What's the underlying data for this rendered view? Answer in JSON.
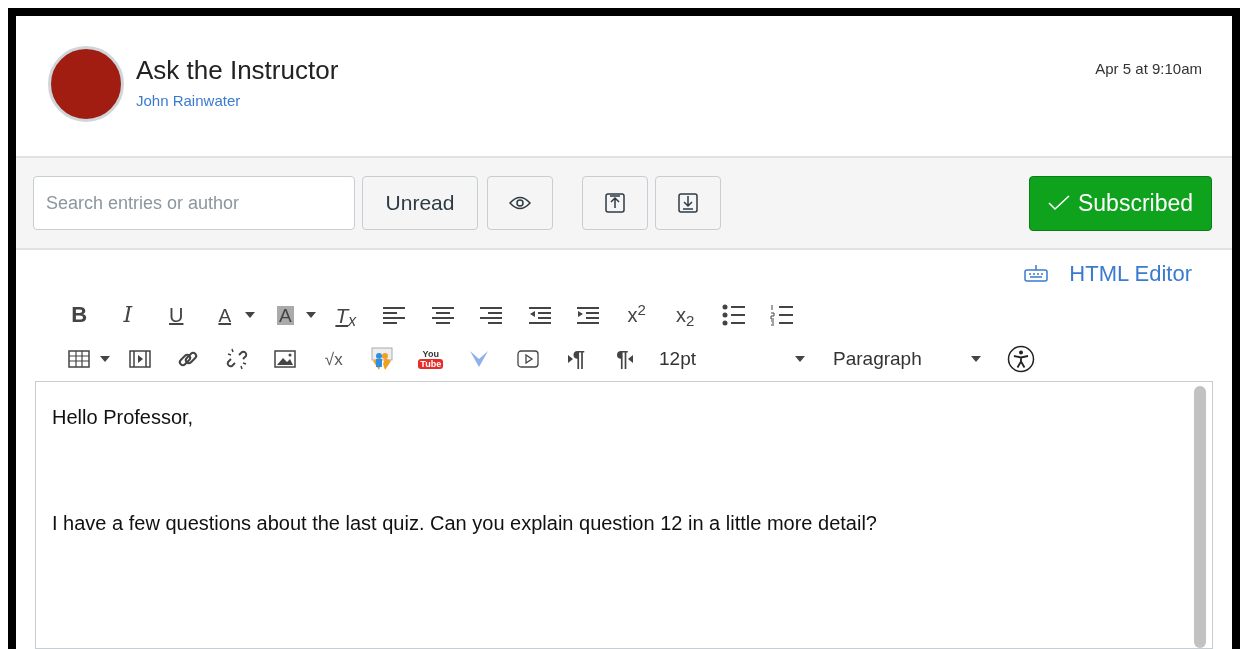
{
  "post": {
    "title": "Ask the Instructor",
    "author": "John Rainwater",
    "timestamp": "Apr 5 at 9:10am"
  },
  "toolbar": {
    "search": {
      "placeholder": "Search entries or author"
    },
    "unread_button": "Unread",
    "subscribe_button": {
      "label": "Subscribed",
      "subscribed": true
    }
  },
  "editor": {
    "html_editor_link": "HTML Editor",
    "row_1": [
      {
        "kind": "bold",
        "text": "B"
      },
      {
        "kind": "italic",
        "text": "I"
      },
      {
        "kind": "underline",
        "text": "U"
      },
      {
        "kind": "text-color",
        "text": "A"
      },
      {
        "kind": "caret"
      },
      {
        "kind": "highlight",
        "text": "A"
      },
      {
        "kind": "caret"
      },
      {
        "kind": "clear-format",
        "text": "T$_{x}$"
      },
      {
        "kind": "align-left"
      },
      {
        "kind": "align-center"
      },
      {
        "kind": "align-right"
      },
      {
        "kind": "outdent"
      },
      {
        "kind": "indent"
      },
      {
        "kind": "superscript",
        "text": "x$^{2}$"
      },
      {
        "kind": "subscript",
        "text": "x$_{2}$"
      },
      {
        "kind": "bullet-list"
      },
      {
        "kind": "numbered-list"
      }
    ],
    "row_2": [
      {
        "kind": "table"
      },
      {
        "kind": "caret"
      },
      {
        "kind": "media"
      },
      {
        "kind": "link"
      },
      {
        "kind": "unlink"
      },
      {
        "kind": "image"
      },
      {
        "kind": "math",
        "text": "√x"
      },
      {
        "kind": "people"
      },
      {
        "kind": "youtube",
        "text": "You",
        "text_2": "Tube"
      },
      {
        "kind": "chevron"
      },
      {
        "kind": "video"
      },
      {
        "kind": "ltr",
        "text": "¶"
      },
      {
        "kind": "rtl",
        "text": "¶"
      }
    ],
    "font_size": "12pt",
    "block_format": "Paragraph",
    "body": [
      "Hello Professor,",
      "I have a few questions about the last quiz. Can you explain question 12 in a little more detail?"
    ]
  }
}
